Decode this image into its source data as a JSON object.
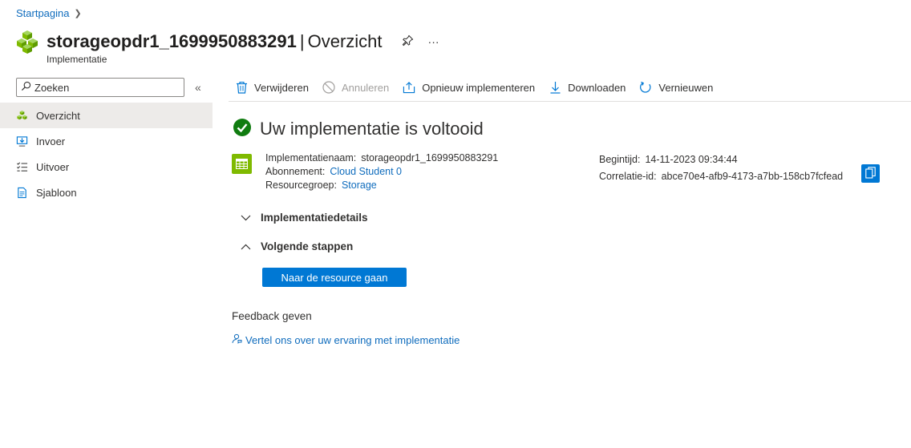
{
  "breadcrumb": {
    "home": "Startpagina"
  },
  "header": {
    "resource_name": "storageopdr1_1699950883291",
    "separator": "|",
    "section": "Overzicht",
    "subtitle": "Implementatie",
    "more": "···"
  },
  "search": {
    "placeholder": "Zoeken"
  },
  "sidebar": {
    "items": [
      {
        "label": "Overzicht",
        "icon": "deployment-icon"
      },
      {
        "label": "Invoer",
        "icon": "input-icon"
      },
      {
        "label": "Uitvoer",
        "icon": "output-icon"
      },
      {
        "label": "Sjabloon",
        "icon": "template-icon"
      }
    ]
  },
  "toolbar": {
    "delete": "Verwijderen",
    "cancel": "Annuleren",
    "redeploy": "Opnieuw implementeren",
    "download": "Downloaden",
    "refresh": "Vernieuwen"
  },
  "status": {
    "title": "Uw implementatie is voltooid"
  },
  "details": {
    "name_label": "Implementatienaam:",
    "name_value": "storageopdr1_1699950883291",
    "subscription_label": "Abonnement:",
    "subscription_value": "Cloud Student 0",
    "rg_label": "Resourcegroep:",
    "rg_value": "Storage",
    "start_label": "Begintijd:",
    "start_value": "14-11-2023 09:34:44",
    "correlation_label": "Correlatie-id:",
    "correlation_value": "abce70e4-afb9-4173-a7bb-158cb7fcfead"
  },
  "sections": {
    "details": "Implementatiedetails",
    "next": "Volgende stappen",
    "go_button": "Naar de resource gaan"
  },
  "feedback": {
    "heading": "Feedback geven",
    "link": "Vertel ons over uw ervaring met implementatie"
  },
  "colors": {
    "accent": "#0078d4",
    "success": "#107c10",
    "resource_green": "#7fba00"
  }
}
